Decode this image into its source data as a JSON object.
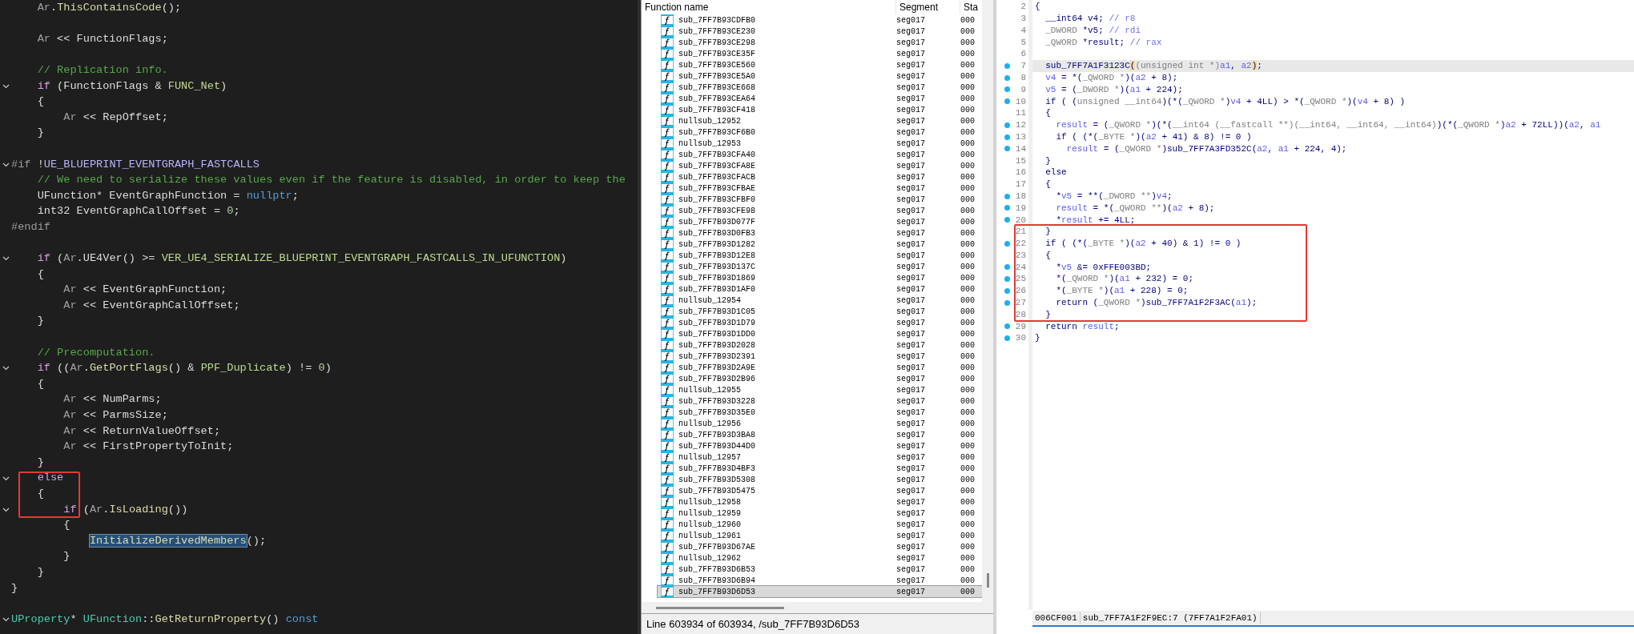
{
  "source_editor": {
    "lines": [
      {
        "fold": false,
        "tokens": [
          {
            "text": "    Ar",
            "kind": "d"
          },
          {
            "text": ".",
            "kind": "p"
          },
          {
            "text": "ThisContainsCode",
            "kind": "f"
          },
          {
            "text": "();",
            "kind": "p"
          }
        ]
      },
      {
        "fold": false
      },
      {
        "fold": false,
        "tokens": [
          {
            "text": "    Ar",
            "kind": "d"
          },
          {
            "text": " << FunctionFlags;",
            "kind": "p"
          }
        ]
      },
      {
        "fold": false
      },
      {
        "fold": false,
        "tokens": [
          {
            "text": "    // Replication info.",
            "kind": "c"
          }
        ]
      },
      {
        "fold": true,
        "tokens": [
          {
            "text": "    if",
            "kind": "k"
          },
          {
            "text": " (FunctionFlags & ",
            "kind": "p"
          },
          {
            "text": "FUNC_Net",
            "kind": "g"
          },
          {
            "text": ")",
            "kind": "p"
          }
        ]
      },
      {
        "fold": false,
        "tokens": [
          {
            "text": "    {",
            "kind": "p"
          }
        ]
      },
      {
        "fold": false,
        "tokens": [
          {
            "text": "        Ar",
            "kind": "d"
          },
          {
            "text": " << RepOffset;",
            "kind": "p"
          }
        ]
      },
      {
        "fold": false,
        "tokens": [
          {
            "text": "    }",
            "kind": "p"
          }
        ]
      },
      {
        "fold": false
      },
      {
        "fold": true,
        "tokens": [
          {
            "text": "#if",
            "kind": "h"
          },
          {
            "text": " !",
            "kind": "p"
          },
          {
            "text": "UE_BLUEPRINT_EVENTGRAPH_FASTCALLS",
            "kind": "m"
          }
        ]
      },
      {
        "fold": false,
        "tokens": [
          {
            "text": "    // We need to serialize these values even if the feature is disabled, in order to keep the",
            "kind": "c"
          }
        ]
      },
      {
        "fold": false,
        "tokens": [
          {
            "text": "    UFunction* EventGraphFunction = ",
            "kind": "p"
          },
          {
            "text": "nullptr",
            "kind": "b"
          },
          {
            "text": ";",
            "kind": "p"
          }
        ]
      },
      {
        "fold": false,
        "tokens": [
          {
            "text": "    int32 EventGraphCallOffset = ",
            "kind": "p"
          },
          {
            "text": "0",
            "kind": "n"
          },
          {
            "text": ";",
            "kind": "p"
          }
        ]
      },
      {
        "fold": false,
        "tokens": [
          {
            "text": "#endif",
            "kind": "h"
          }
        ]
      },
      {
        "fold": false
      },
      {
        "fold": true,
        "tokens": [
          {
            "text": "    if",
            "kind": "k"
          },
          {
            "text": " (",
            "kind": "p"
          },
          {
            "text": "Ar",
            "kind": "d"
          },
          {
            "text": ".UE4Ver() >= ",
            "kind": "p"
          },
          {
            "text": "VER_UE4_SERIALIZE_BLUEPRINT_EVENTGRAPH_FASTCALLS_IN_UFUNCTION",
            "kind": "g"
          },
          {
            "text": ")",
            "kind": "p"
          }
        ]
      },
      {
        "fold": false,
        "tokens": [
          {
            "text": "    {",
            "kind": "p"
          }
        ]
      },
      {
        "fold": false,
        "tokens": [
          {
            "text": "        Ar",
            "kind": "d"
          },
          {
            "text": " << EventGraphFunction;",
            "kind": "p"
          }
        ]
      },
      {
        "fold": false,
        "tokens": [
          {
            "text": "        Ar",
            "kind": "d"
          },
          {
            "text": " << EventGraphCallOffset;",
            "kind": "p"
          }
        ]
      },
      {
        "fold": false,
        "tokens": [
          {
            "text": "    }",
            "kind": "p"
          }
        ]
      },
      {
        "fold": false
      },
      {
        "fold": false,
        "tokens": [
          {
            "text": "    // Precomputation.",
            "kind": "c"
          }
        ]
      },
      {
        "fold": true,
        "tokens": [
          {
            "text": "    if",
            "kind": "k"
          },
          {
            "text": " ((",
            "kind": "p"
          },
          {
            "text": "Ar",
            "kind": "d"
          },
          {
            "text": ".",
            "kind": "p"
          },
          {
            "text": "GetPortFlags",
            "kind": "f"
          },
          {
            "text": "() & ",
            "kind": "p"
          },
          {
            "text": "PPF_Duplicate",
            "kind": "g"
          },
          {
            "text": ") != ",
            "kind": "p"
          },
          {
            "text": "0",
            "kind": "n"
          },
          {
            "text": ")",
            "kind": "p"
          }
        ]
      },
      {
        "fold": false,
        "tokens": [
          {
            "text": "    {",
            "kind": "p"
          }
        ]
      },
      {
        "fold": false,
        "tokens": [
          {
            "text": "        Ar",
            "kind": "d"
          },
          {
            "text": " << NumParms;",
            "kind": "p"
          }
        ]
      },
      {
        "fold": false,
        "tokens": [
          {
            "text": "        Ar",
            "kind": "d"
          },
          {
            "text": " << ParmsSize;",
            "kind": "p"
          }
        ]
      },
      {
        "fold": false,
        "tokens": [
          {
            "text": "        Ar",
            "kind": "d"
          },
          {
            "text": " << ReturnValueOffset;",
            "kind": "p"
          }
        ]
      },
      {
        "fold": false,
        "tokens": [
          {
            "text": "        Ar",
            "kind": "d"
          },
          {
            "text": " << FirstPropertyToInit;",
            "kind": "p"
          }
        ]
      },
      {
        "fold": false,
        "tokens": [
          {
            "text": "    }",
            "kind": "p"
          }
        ]
      },
      {
        "fold": true,
        "tokens": [
          {
            "text": "    else",
            "kind": "k"
          }
        ]
      },
      {
        "fold": false,
        "tokens": [
          {
            "text": "    {",
            "kind": "p"
          }
        ]
      },
      {
        "fold": true,
        "tokens": [
          {
            "text": "        if",
            "kind": "k"
          },
          {
            "text": " (",
            "kind": "p"
          },
          {
            "text": "Ar",
            "kind": "d"
          },
          {
            "text": ".",
            "kind": "p"
          },
          {
            "text": "IsLoading",
            "kind": "f"
          },
          {
            "text": "())",
            "kind": "p"
          }
        ]
      },
      {
        "fold": false,
        "tokens": [
          {
            "text": "        {",
            "kind": "p"
          }
        ]
      },
      {
        "fold": false,
        "tokens": [
          {
            "text": "            InitializeDerivedMembers",
            "kind": "s"
          },
          {
            "text": "();",
            "kind": "p"
          }
        ]
      },
      {
        "fold": false,
        "tokens": [
          {
            "text": "        }",
            "kind": "p"
          }
        ]
      },
      {
        "fold": false,
        "tokens": [
          {
            "text": "    }",
            "kind": "p"
          }
        ]
      },
      {
        "fold": false,
        "tokens": [
          {
            "text": "}",
            "kind": "p"
          }
        ]
      },
      {
        "fold": false
      },
      {
        "fold": true,
        "tokens": [
          {
            "text": "UProperty",
            "kind": "t"
          },
          {
            "text": "* ",
            "kind": "p"
          },
          {
            "text": "UFunction",
            "kind": "t"
          },
          {
            "text": "::",
            "kind": "p"
          },
          {
            "text": "GetReturnProperty",
            "kind": "f"
          },
          {
            "text": "() ",
            "kind": "p"
          },
          {
            "text": "const",
            "kind": "b"
          }
        ]
      }
    ]
  },
  "functions_window": {
    "columns": [
      "Function name",
      "Segment",
      "Sta"
    ],
    "rows": [
      {
        "name": "sub_7FF7B93CDFB0",
        "segment": "seg017",
        "start": "000",
        "selected": false
      },
      {
        "name": "sub_7FF7B93CE230",
        "segment": "seg017",
        "start": "000",
        "selected": false
      },
      {
        "name": "sub_7FF7B93CE298",
        "segment": "seg017",
        "start": "000",
        "selected": false
      },
      {
        "name": "sub_7FF7B93CE35F",
        "segment": "seg017",
        "start": "000",
        "selected": false
      },
      {
        "name": "sub_7FF7B93CE560",
        "segment": "seg017",
        "start": "000",
        "selected": false
      },
      {
        "name": "sub_7FF7B93CE5A0",
        "segment": "seg017",
        "start": "000",
        "selected": false
      },
      {
        "name": "sub_7FF7B93CE668",
        "segment": "seg017",
        "start": "000",
        "selected": false
      },
      {
        "name": "sub_7FF7B93CEA64",
        "segment": "seg017",
        "start": "000",
        "selected": false
      },
      {
        "name": "sub_7FF7B93CF418",
        "segment": "seg017",
        "start": "000",
        "selected": false
      },
      {
        "name": "nullsub_12952",
        "segment": "seg017",
        "start": "000",
        "selected": false
      },
      {
        "name": "sub_7FF7B93CF6B0",
        "segment": "seg017",
        "start": "000",
        "selected": false
      },
      {
        "name": "nullsub_12953",
        "segment": "seg017",
        "start": "000",
        "selected": false
      },
      {
        "name": "sub_7FF7B93CFA40",
        "segment": "seg017",
        "start": "000",
        "selected": false
      },
      {
        "name": "sub_7FF7B93CFA8E",
        "segment": "seg017",
        "start": "000",
        "selected": false
      },
      {
        "name": "sub_7FF7B93CFACB",
        "segment": "seg017",
        "start": "000",
        "selected": false
      },
      {
        "name": "sub_7FF7B93CFBAE",
        "segment": "seg017",
        "start": "000",
        "selected": false
      },
      {
        "name": "sub_7FF7B93CFBF0",
        "segment": "seg017",
        "start": "000",
        "selected": false
      },
      {
        "name": "sub_7FF7B93CFE98",
        "segment": "seg017",
        "start": "000",
        "selected": false
      },
      {
        "name": "sub_7FF7B93D077F",
        "segment": "seg017",
        "start": "000",
        "selected": false
      },
      {
        "name": "sub_7FF7B93D0FB3",
        "segment": "seg017",
        "start": "000",
        "selected": false
      },
      {
        "name": "sub_7FF7B93D1282",
        "segment": "seg017",
        "start": "000",
        "selected": false
      },
      {
        "name": "sub_7FF7B93D12E8",
        "segment": "seg017",
        "start": "000",
        "selected": false
      },
      {
        "name": "sub_7FF7B93D137C",
        "segment": "seg017",
        "start": "000",
        "selected": false
      },
      {
        "name": "sub_7FF7B93D1869",
        "segment": "seg017",
        "start": "000",
        "selected": false
      },
      {
        "name": "sub_7FF7B93D1AF0",
        "segment": "seg017",
        "start": "000",
        "selected": false
      },
      {
        "name": "nullsub_12954",
        "segment": "seg017",
        "start": "000",
        "selected": false
      },
      {
        "name": "sub_7FF7B93D1C05",
        "segment": "seg017",
        "start": "000",
        "selected": false
      },
      {
        "name": "sub_7FF7B93D1D79",
        "segment": "seg017",
        "start": "000",
        "selected": false
      },
      {
        "name": "sub_7FF7B93D1DD0",
        "segment": "seg017",
        "start": "000",
        "selected": false
      },
      {
        "name": "sub_7FF7B93D2028",
        "segment": "seg017",
        "start": "000",
        "selected": false
      },
      {
        "name": "sub_7FF7B93D2391",
        "segment": "seg017",
        "start": "000",
        "selected": false
      },
      {
        "name": "sub_7FF7B93D2A9E",
        "segment": "seg017",
        "start": "000",
        "selected": false
      },
      {
        "name": "sub_7FF7B93D2B96",
        "segment": "seg017",
        "start": "000",
        "selected": false
      },
      {
        "name": "nullsub_12955",
        "segment": "seg017",
        "start": "000",
        "selected": false
      },
      {
        "name": "sub_7FF7B93D3228",
        "segment": "seg017",
        "start": "000",
        "selected": false
      },
      {
        "name": "sub_7FF7B93D35E0",
        "segment": "seg017",
        "start": "000",
        "selected": false
      },
      {
        "name": "nullsub_12956",
        "segment": "seg017",
        "start": "000",
        "selected": false
      },
      {
        "name": "sub_7FF7B93D3BA8",
        "segment": "seg017",
        "start": "000",
        "selected": false
      },
      {
        "name": "sub_7FF7B93D44D0",
        "segment": "seg017",
        "start": "000",
        "selected": false
      },
      {
        "name": "nullsub_12957",
        "segment": "seg017",
        "start": "000",
        "selected": false
      },
      {
        "name": "sub_7FF7B93D4BF3",
        "segment": "seg017",
        "start": "000",
        "selected": false
      },
      {
        "name": "sub_7FF7B93D5308",
        "segment": "seg017",
        "start": "000",
        "selected": false
      },
      {
        "name": "sub_7FF7B93D5475",
        "segment": "seg017",
        "start": "000",
        "selected": false
      },
      {
        "name": "nullsub_12958",
        "segment": "seg017",
        "start": "000",
        "selected": false
      },
      {
        "name": "nullsub_12959",
        "segment": "seg017",
        "start": "000",
        "selected": false
      },
      {
        "name": "nullsub_12960",
        "segment": "seg017",
        "start": "000",
        "selected": false
      },
      {
        "name": "nullsub_12961",
        "segment": "seg017",
        "start": "000",
        "selected": false
      },
      {
        "name": "sub_7FF7B93D67AE",
        "segment": "seg017",
        "start": "000",
        "selected": false
      },
      {
        "name": "nullsub_12962",
        "segment": "seg017",
        "start": "000",
        "selected": false
      },
      {
        "name": "sub_7FF7B93D6B53",
        "segment": "seg017",
        "start": "000",
        "selected": false
      },
      {
        "name": "sub_7FF7B93D6B94",
        "segment": "seg017",
        "start": "000",
        "selected": false
      },
      {
        "name": "sub_7FF7B93D6D53",
        "segment": "seg017",
        "start": "000",
        "selected": true
      }
    ],
    "status": "Line 603934 of 603934, /sub_7FF7B93D6D53"
  },
  "pseudocode": {
    "lines": [
      {
        "number": "2",
        "dot": false,
        "current": false,
        "tokens": [
          {
            "text": "{",
            "kind": "p"
          }
        ]
      },
      {
        "number": "3",
        "dot": false,
        "current": false,
        "tokens": [
          {
            "text": "  __int64 v4; ",
            "kind": "p"
          },
          {
            "text": "// r8",
            "kind": "c"
          }
        ]
      },
      {
        "number": "4",
        "dot": false,
        "current": false,
        "tokens": [
          {
            "text": "  _DWORD",
            "kind": "t"
          },
          {
            "text": " *v5; ",
            "kind": "p"
          },
          {
            "text": "// rdi",
            "kind": "c"
          }
        ]
      },
      {
        "number": "5",
        "dot": false,
        "current": false,
        "tokens": [
          {
            "text": "  _QWORD",
            "kind": "t"
          },
          {
            "text": " *result; ",
            "kind": "p"
          },
          {
            "text": "// rax",
            "kind": "c"
          }
        ]
      },
      {
        "number": "6",
        "dot": false,
        "current": false
      },
      {
        "number": "7",
        "dot": true,
        "current": true,
        "tokens": [
          {
            "text": "  sub_7FF7A1F3123C",
            "kind": "p"
          },
          {
            "text": "(",
            "kind": "h"
          },
          {
            "text": "(unsigned int *)",
            "kind": "t"
          },
          {
            "text": "a1",
            "kind": "v"
          },
          {
            "text": ", ",
            "kind": "p"
          },
          {
            "text": "a2",
            "kind": "v"
          },
          {
            "text": ")",
            "kind": "h"
          },
          {
            "text": ";",
            "kind": "p"
          }
        ]
      },
      {
        "number": "8",
        "dot": true,
        "current": false,
        "tokens": [
          {
            "text": "  v4",
            "kind": "v"
          },
          {
            "text": " = *(",
            "kind": "p"
          },
          {
            "text": "_QWORD *",
            "kind": "t"
          },
          {
            "text": ")(",
            "kind": "p"
          },
          {
            "text": "a2",
            "kind": "v"
          },
          {
            "text": " + 8);",
            "kind": "p"
          }
        ]
      },
      {
        "number": "9",
        "dot": true,
        "current": false,
        "tokens": [
          {
            "text": "  v5",
            "kind": "v"
          },
          {
            "text": " = (",
            "kind": "p"
          },
          {
            "text": "_DWORD *",
            "kind": "t"
          },
          {
            "text": ")(",
            "kind": "p"
          },
          {
            "text": "a1",
            "kind": "v"
          },
          {
            "text": " + 224);",
            "kind": "p"
          }
        ]
      },
      {
        "number": "10",
        "dot": true,
        "current": false,
        "tokens": [
          {
            "text": "  if ( (",
            "kind": "p"
          },
          {
            "text": "unsigned __int64",
            "kind": "t"
          },
          {
            "text": ")(*(",
            "kind": "p"
          },
          {
            "text": "_QWORD *",
            "kind": "t"
          },
          {
            "text": ")",
            "kind": "p"
          },
          {
            "text": "v4",
            "kind": "v"
          },
          {
            "text": " + 4LL) > *(",
            "kind": "p"
          },
          {
            "text": "_QWORD *",
            "kind": "t"
          },
          {
            "text": ")(",
            "kind": "p"
          },
          {
            "text": "v4",
            "kind": "v"
          },
          {
            "text": " + 8) )",
            "kind": "p"
          }
        ]
      },
      {
        "number": "11",
        "dot": false,
        "current": false,
        "tokens": [
          {
            "text": "  {",
            "kind": "p"
          }
        ]
      },
      {
        "number": "12",
        "dot": true,
        "current": false,
        "tokens": [
          {
            "text": "    result",
            "kind": "v"
          },
          {
            "text": " = (",
            "kind": "p"
          },
          {
            "text": "_QWORD *",
            "kind": "t"
          },
          {
            "text": ")(*(",
            "kind": "p"
          },
          {
            "text": "__int64 (__fastcall **)(__int64, __int64, __int64)",
            "kind": "t"
          },
          {
            "text": ")(*(",
            "kind": "p"
          },
          {
            "text": "_QWORD *",
            "kind": "t"
          },
          {
            "text": ")",
            "kind": "p"
          },
          {
            "text": "a2",
            "kind": "v"
          },
          {
            "text": " + 72LL))(",
            "kind": "p"
          },
          {
            "text": "a2",
            "kind": "v"
          },
          {
            "text": ", ",
            "kind": "p"
          },
          {
            "text": "a1",
            "kind": "v"
          }
        ]
      },
      {
        "number": "13",
        "dot": true,
        "current": false,
        "tokens": [
          {
            "text": "    if ( (*(",
            "kind": "p"
          },
          {
            "text": "_BYTE *",
            "kind": "t"
          },
          {
            "text": ")(",
            "kind": "p"
          },
          {
            "text": "a2",
            "kind": "v"
          },
          {
            "text": " + 41) & 8) != 0 )",
            "kind": "p"
          }
        ]
      },
      {
        "number": "14",
        "dot": true,
        "current": false,
        "tokens": [
          {
            "text": "      result",
            "kind": "v"
          },
          {
            "text": " = (",
            "kind": "p"
          },
          {
            "text": "_QWORD *",
            "kind": "t"
          },
          {
            "text": ")sub_7FF7A3FD352C(",
            "kind": "p"
          },
          {
            "text": "a2",
            "kind": "v"
          },
          {
            "text": ", ",
            "kind": "p"
          },
          {
            "text": "a1",
            "kind": "v"
          },
          {
            "text": " + 224, 4);",
            "kind": "p"
          }
        ]
      },
      {
        "number": "15",
        "dot": false,
        "current": false,
        "tokens": [
          {
            "text": "  }",
            "kind": "p"
          }
        ]
      },
      {
        "number": "16",
        "dot": false,
        "current": false,
        "tokens": [
          {
            "text": "  else",
            "kind": "p"
          }
        ]
      },
      {
        "number": "17",
        "dot": false,
        "current": false,
        "tokens": [
          {
            "text": "  {",
            "kind": "p"
          }
        ]
      },
      {
        "number": "18",
        "dot": true,
        "current": false,
        "tokens": [
          {
            "text": "    *",
            "kind": "p"
          },
          {
            "text": "v5",
            "kind": "v"
          },
          {
            "text": " = **(",
            "kind": "p"
          },
          {
            "text": "_DWORD **",
            "kind": "t"
          },
          {
            "text": ")",
            "kind": "p"
          },
          {
            "text": "v4",
            "kind": "v"
          },
          {
            "text": ";",
            "kind": "p"
          }
        ]
      },
      {
        "number": "19",
        "dot": true,
        "current": false,
        "tokens": [
          {
            "text": "    result",
            "kind": "v"
          },
          {
            "text": " = *(",
            "kind": "p"
          },
          {
            "text": "_QWORD **",
            "kind": "t"
          },
          {
            "text": ")(",
            "kind": "p"
          },
          {
            "text": "a2",
            "kind": "v"
          },
          {
            "text": " + 8);",
            "kind": "p"
          }
        ]
      },
      {
        "number": "20",
        "dot": true,
        "current": false,
        "tokens": [
          {
            "text": "    *",
            "kind": "p"
          },
          {
            "text": "result",
            "kind": "v"
          },
          {
            "text": " += 4LL;",
            "kind": "p"
          }
        ]
      },
      {
        "number": "21",
        "dot": false,
        "current": false,
        "tokens": [
          {
            "text": "  }",
            "kind": "p"
          }
        ]
      },
      {
        "number": "22",
        "dot": true,
        "current": false,
        "tokens": [
          {
            "text": "  if ( (*(",
            "kind": "p"
          },
          {
            "text": "_BYTE *",
            "kind": "t"
          },
          {
            "text": ")(",
            "kind": "p"
          },
          {
            "text": "a2",
            "kind": "v"
          },
          {
            "text": " + 40) & 1) != 0 )",
            "kind": "p"
          }
        ]
      },
      {
        "number": "23",
        "dot": false,
        "current": false,
        "tokens": [
          {
            "text": "  {",
            "kind": "p"
          }
        ]
      },
      {
        "number": "24",
        "dot": true,
        "current": false,
        "tokens": [
          {
            "text": "    *",
            "kind": "p"
          },
          {
            "text": "v5",
            "kind": "v"
          },
          {
            "text": " &= 0xFFE003BD;",
            "kind": "p"
          }
        ]
      },
      {
        "number": "25",
        "dot": true,
        "current": false,
        "tokens": [
          {
            "text": "    *(",
            "kind": "p"
          },
          {
            "text": "_QWORD *",
            "kind": "t"
          },
          {
            "text": ")(",
            "kind": "p"
          },
          {
            "text": "a1",
            "kind": "v"
          },
          {
            "text": " + 232) = 0;",
            "kind": "p"
          }
        ]
      },
      {
        "number": "26",
        "dot": true,
        "current": false,
        "tokens": [
          {
            "text": "    *(",
            "kind": "p"
          },
          {
            "text": "_BYTE *",
            "kind": "t"
          },
          {
            "text": ")(",
            "kind": "p"
          },
          {
            "text": "a1",
            "kind": "v"
          },
          {
            "text": " + 228) = 0;",
            "kind": "p"
          }
        ]
      },
      {
        "number": "27",
        "dot": true,
        "current": false,
        "tokens": [
          {
            "text": "    return (",
            "kind": "p"
          },
          {
            "text": "_QWORD *",
            "kind": "t"
          },
          {
            "text": ")sub_7FF7A1F2F3AC(",
            "kind": "p"
          },
          {
            "text": "a1",
            "kind": "v"
          },
          {
            "text": ");",
            "kind": "p"
          }
        ]
      },
      {
        "number": "28",
        "dot": false,
        "current": false,
        "tokens": [
          {
            "text": "  }",
            "kind": "p"
          }
        ]
      },
      {
        "number": "29",
        "dot": true,
        "current": false,
        "tokens": [
          {
            "text": "  return ",
            "kind": "p"
          },
          {
            "text": "result",
            "kind": "v"
          },
          {
            "text": ";",
            "kind": "p"
          }
        ]
      },
      {
        "number": "30",
        "dot": true,
        "current": false,
        "tokens": [
          {
            "text": "}",
            "kind": "p"
          }
        ]
      }
    ],
    "status_bar": [
      "006CF001",
      "sub_7FF7A1F2F9EC:7 (7FF7A1F2FA01)"
    ]
  }
}
